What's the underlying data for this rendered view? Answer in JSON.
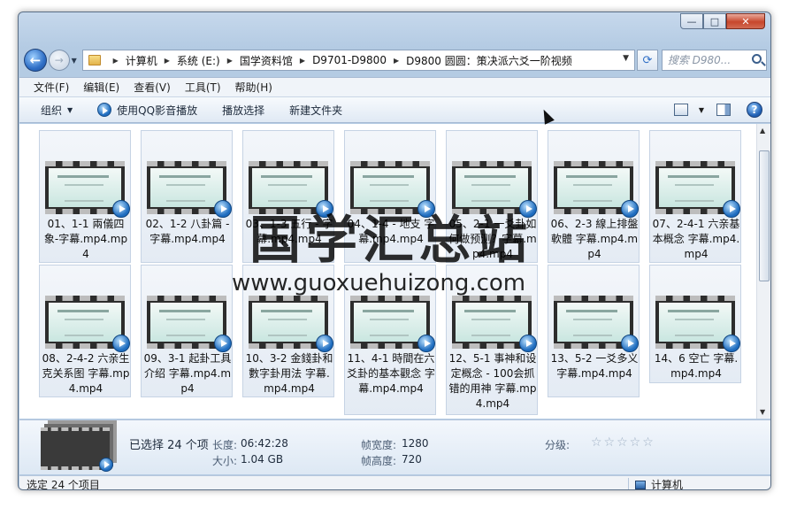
{
  "window": {
    "caption_buttons": [
      "minimize-icon",
      "maximize-icon",
      "close-icon"
    ]
  },
  "nav": {
    "breadcrumbs": [
      "计算机",
      "系统 (E:)",
      "国学资料馆",
      "D9701-D9800",
      "D9800 圆圆：策决派六爻一阶视频"
    ],
    "search_placeholder": "搜索 D980..."
  },
  "menu": [
    "文件(F)",
    "编辑(E)",
    "查看(V)",
    "工具(T)",
    "帮助(H)"
  ],
  "toolbar": {
    "organize": "组织",
    "qq_play": "使用QQ影音播放",
    "play_selection": "播放选择",
    "new_folder": "新建文件夹"
  },
  "files": [
    "01、1-1 兩儀四象-字幕.mp4.mp4",
    "02、1-2 八卦篇 - 字幕.mp4.mp4",
    "03、1-3 五行 - 字幕.mp4.mp4",
    "04、1-4 - 地支 字幕.mp4.mp4",
    "05、2-1 一爻卦如何做预测？字幕.mp4.mp4",
    "06、2-3 線上排盤軟體 字幕.mp4.mp4",
    "07、2-4-1 六亲基本概念 字幕.mp4.mp4",
    "08、2-4-2 六亲生克关系图 字幕.mp4.mp4",
    "09、3-1 起卦工具介绍 字幕.mp4.mp4",
    "10、3-2 金錢卦和數字卦用法 字幕.mp4.mp4",
    "11、4-1 時間在六爻卦的基本觀念 字幕.mp4.mp4",
    "12、5-1 事神和设定概念 - 100会抓错的用神 字幕.mp4.mp4",
    "13、5-2 一爻多义 字幕.mp4.mp4",
    "14、6 空亡 字幕.mp4.mp4"
  ],
  "watermark": {
    "title": "国学汇总站",
    "url": "www.guoxuehuizong.com"
  },
  "details": {
    "selected": "已选择 24 个项",
    "length_label": "长度:",
    "length_value": "06:42:28",
    "size_label": "大小:",
    "size_value": "1.04 GB",
    "frame_width_label": "帧宽度:",
    "frame_width_value": "1280",
    "frame_height_label": "帧高度:",
    "frame_height_value": "720",
    "rating_label": "分级:",
    "rating_stars": "☆☆☆☆☆"
  },
  "status": {
    "left": "选定 24 个项目",
    "right": "计算机"
  }
}
